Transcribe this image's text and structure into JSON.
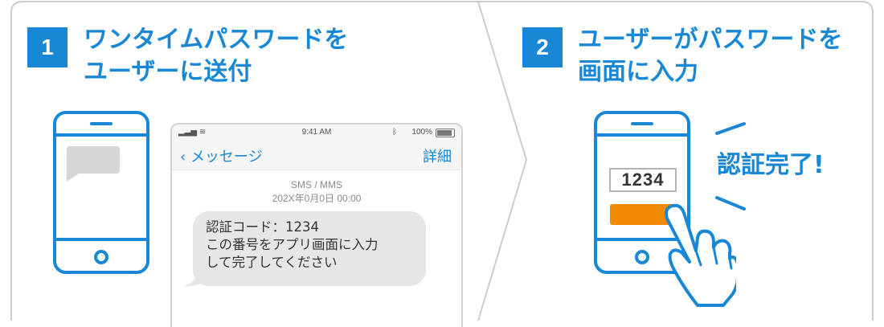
{
  "steps": [
    {
      "number": "1",
      "title_line1": "ワンタイムパスワードを",
      "title_line2": "ユーザーに送付"
    },
    {
      "number": "2",
      "title_line1": "ユーザーがパスワードを",
      "title_line2": "画面に入力"
    }
  ],
  "message_app": {
    "status_time": "9:41 AM",
    "battery": "100%",
    "back_label": "メッセージ",
    "detail_label": "詳細",
    "sms_type": "SMS / MMS",
    "date": "202X年0月0日 00:00",
    "message_lines": [
      "認証コード：1234",
      "この番号をアプリ画面に入力",
      "して完了してください"
    ]
  },
  "entry": {
    "code": "1234",
    "done_label": "認証完了!"
  },
  "colors": {
    "accent": "#1787d6",
    "button": "#f08a00",
    "bubble": "#e6e6e6",
    "frame": "#cccccc"
  },
  "icons": [
    "phone-icon",
    "chat-bubble-icon",
    "hand-pointer-icon",
    "signal-icon",
    "wifi-icon",
    "bluetooth-icon",
    "battery-icon",
    "chevron-left-icon"
  ]
}
